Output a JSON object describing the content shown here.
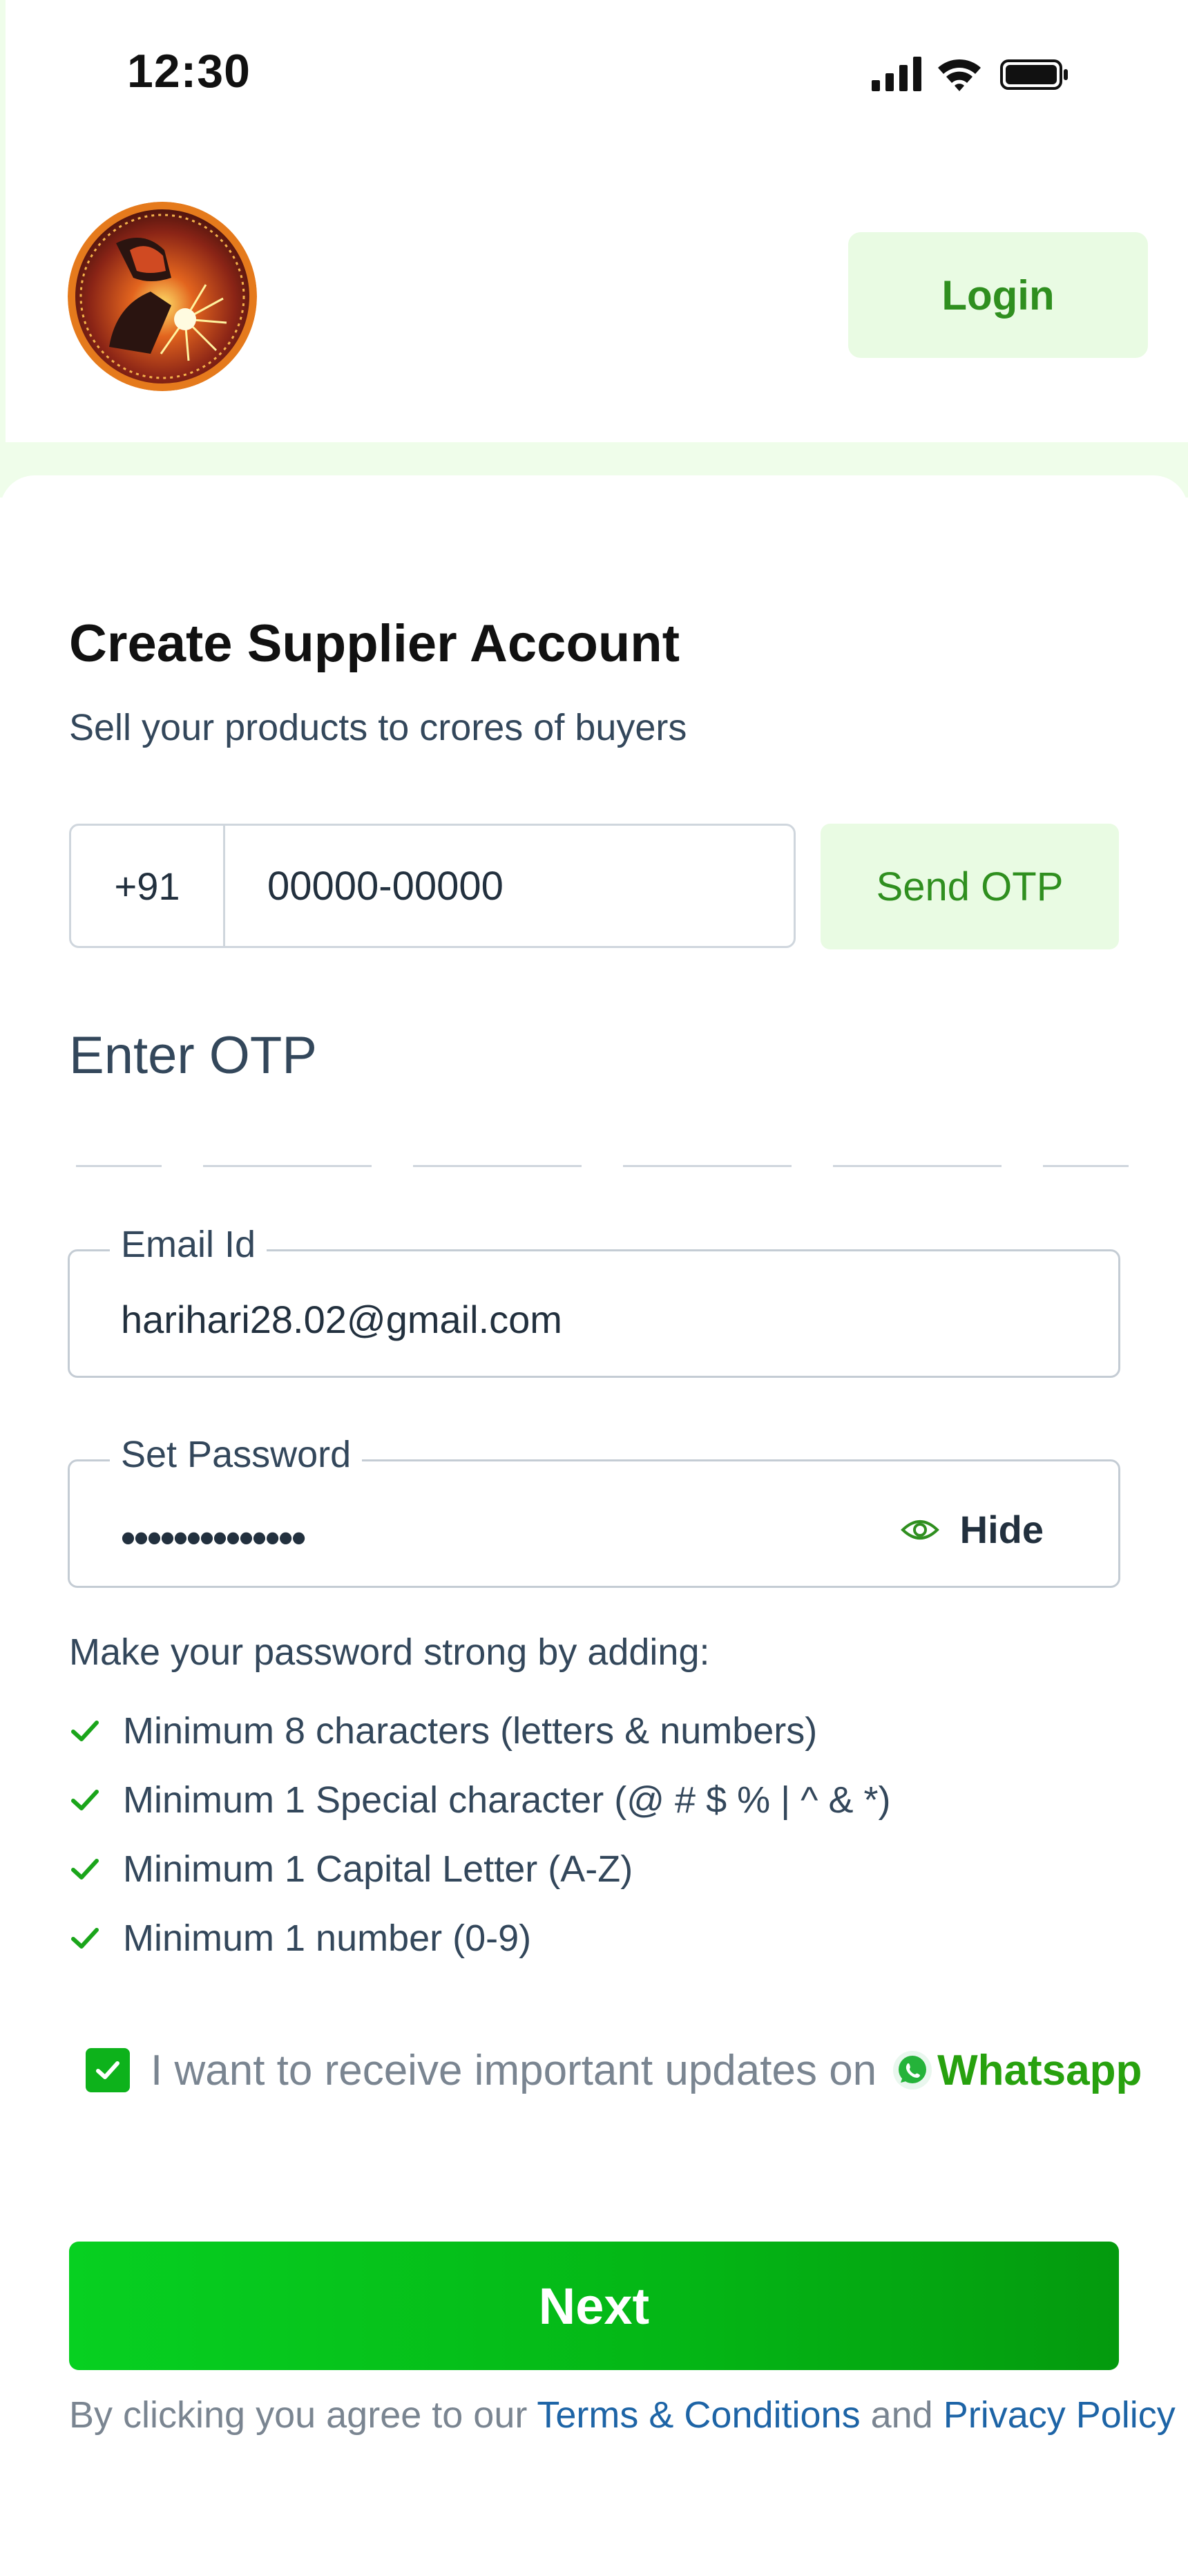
{
  "status_bar": {
    "time": "12:30"
  },
  "header": {
    "login_label": "Login"
  },
  "form": {
    "title": "Create Supplier Account",
    "subtitle": "Sell your products to crores of buyers",
    "country_code": "+91",
    "phone_placeholder": "00000-00000",
    "send_otp_label": "Send OTP",
    "otp_label": "Enter OTP",
    "otp_digits": 6,
    "email": {
      "label": "Email Id",
      "value": "harihari28.02@gmail.com"
    },
    "password": {
      "label": "Set Password",
      "masked_value": "••••••••••••••",
      "toggle_label": "Hide"
    }
  },
  "password_rules": {
    "title": "Make your password strong by adding:",
    "items": [
      "Minimum 8 characters (letters & numbers)",
      "Minimum 1 Special character (@ # $ % | ^ & *)",
      "Minimum 1 Capital Letter (A-Z)",
      "Minimum 1 number (0-9)"
    ],
    "check_color": "#1aa51a"
  },
  "whatsapp_optin": {
    "checked": true,
    "text": "I want to receive important updates on",
    "link": "Whatsapp"
  },
  "next_label": "Next",
  "agreement": {
    "prefix": "By clicking you agree to our",
    "terms": "Terms & Conditions",
    "and": "and",
    "privacy": "Privacy Policy"
  },
  "colors": {
    "accent_green": "#2f8f1f",
    "light_green": "#e9fbe3",
    "button_green": "#04b515",
    "link_blue": "#1d64a6"
  }
}
